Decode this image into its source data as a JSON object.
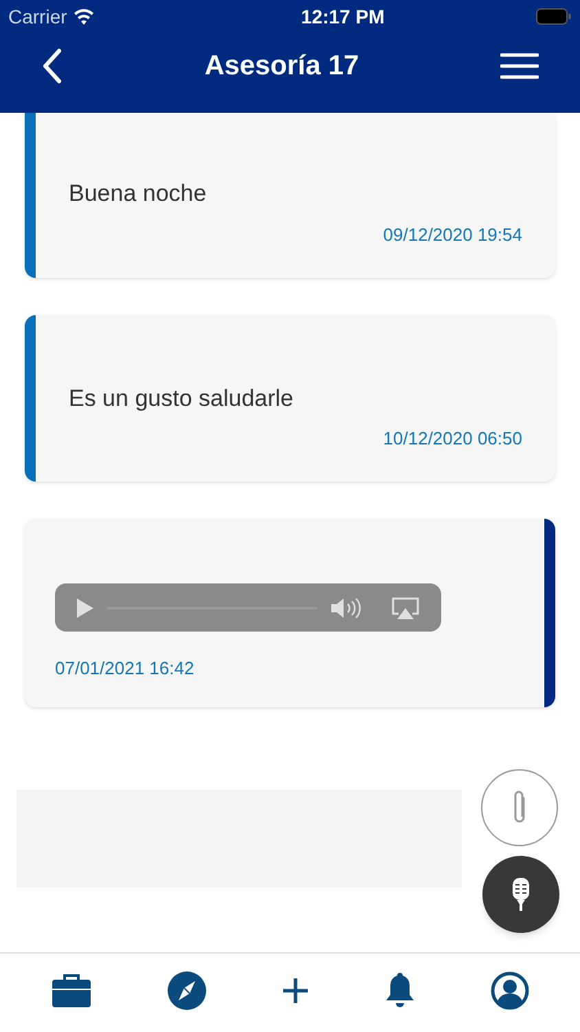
{
  "status_bar": {
    "carrier": "Carrier",
    "time": "12:17 PM"
  },
  "header": {
    "title": "Asesoría 17"
  },
  "messages": [
    {
      "kind": "text",
      "text": "Buena noche",
      "time": "09/12/2020 19:54"
    },
    {
      "kind": "text",
      "text": "Es un gusto saludarle",
      "time": "10/12/2020 06:50"
    },
    {
      "kind": "audio",
      "time": "07/01/2021 16:42"
    }
  ]
}
